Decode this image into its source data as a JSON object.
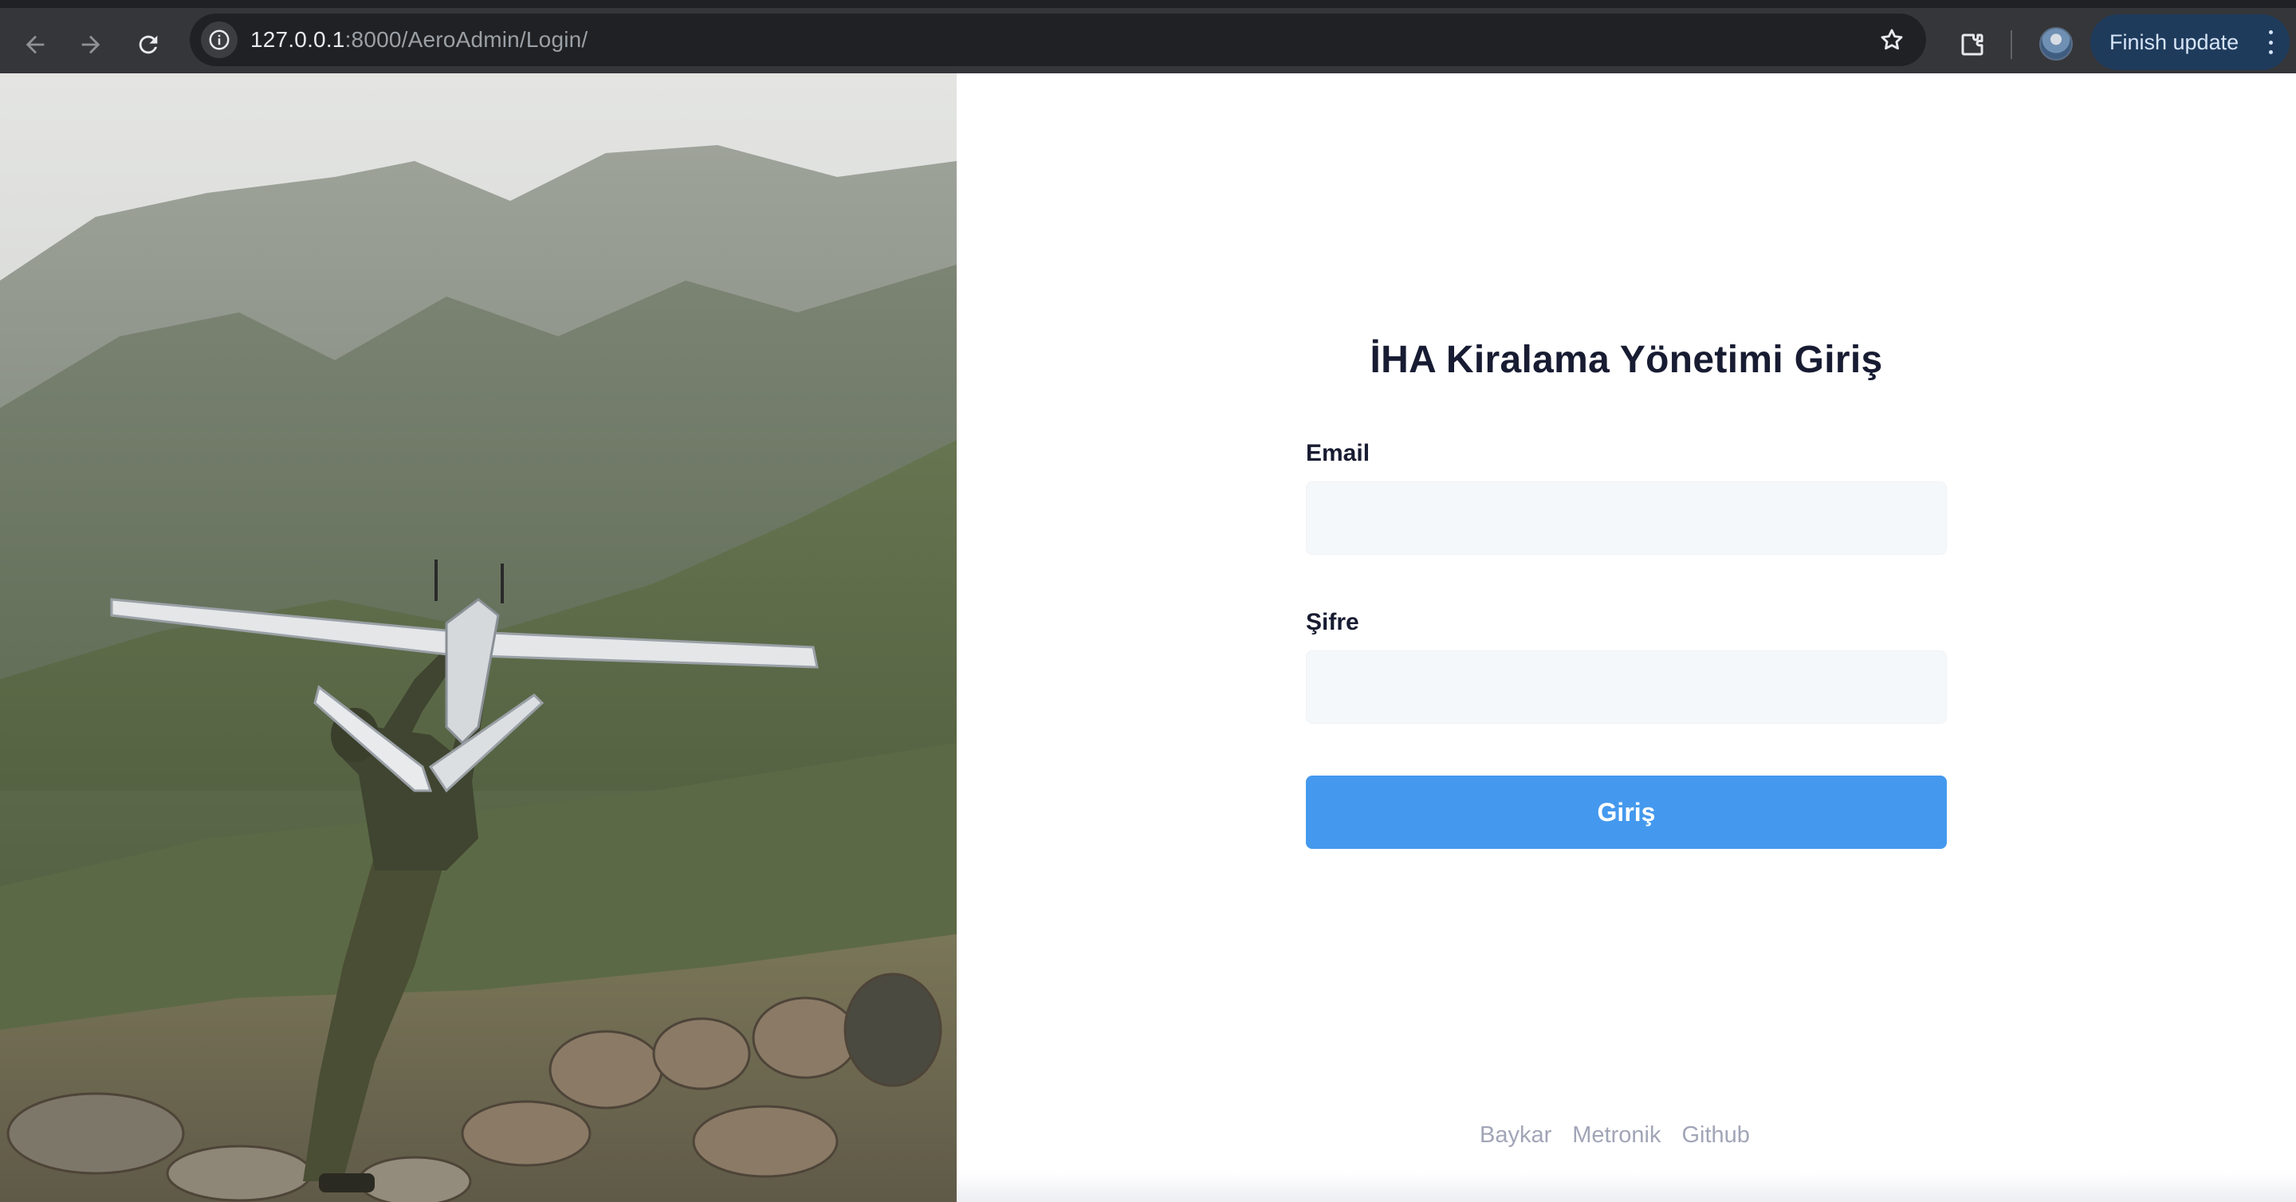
{
  "browser": {
    "url_host": "127.0.0.1",
    "url_path": ":8000/AeroAdmin/Login/",
    "update_button_label": "Finish update",
    "icons": {
      "back": "arrow-left-icon",
      "forward": "arrow-right-icon",
      "reload": "reload-icon",
      "site_info": "info-icon",
      "bookmark": "star-icon",
      "extensions": "puzzle-icon",
      "menu": "more-vertical-icon"
    }
  },
  "login": {
    "title": "İHA Kiralama Yönetimi Giriş",
    "email_label": "Email",
    "email_value": "",
    "password_label": "Şifre",
    "password_value": "",
    "submit_label": "Giriş"
  },
  "footer": {
    "links": [
      "Baykar",
      "Metronik",
      "Github"
    ]
  },
  "colors": {
    "accent": "#4499ee",
    "title": "#181c32",
    "input_background": "#f5f8fa",
    "footer_link": "#a1a5b7"
  }
}
